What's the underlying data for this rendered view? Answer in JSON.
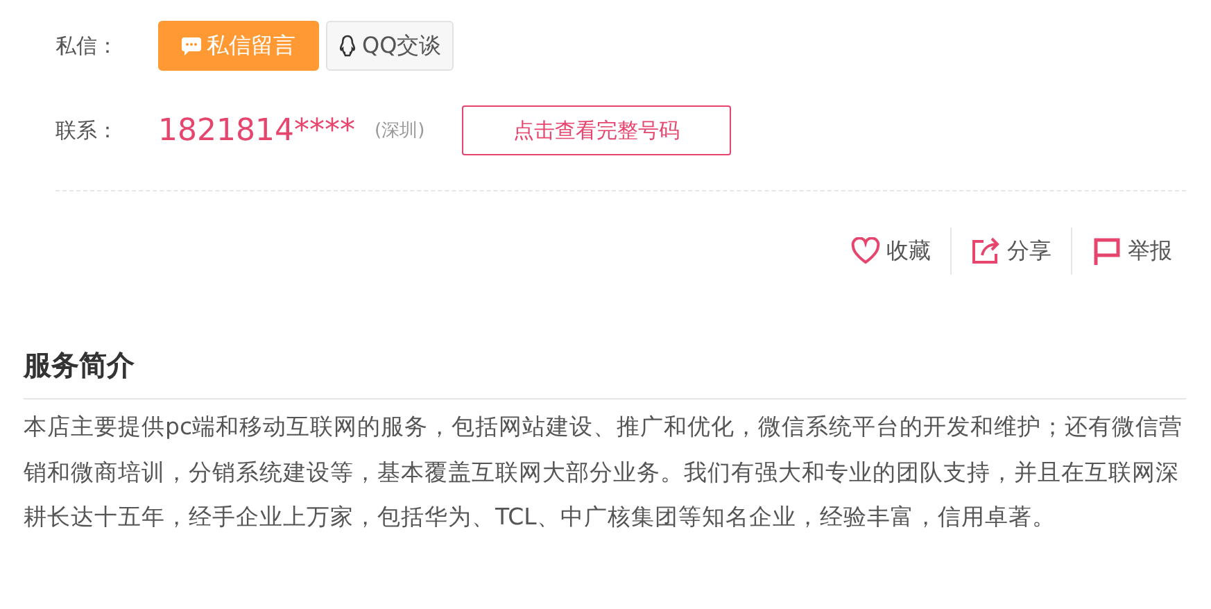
{
  "message_row": {
    "label": "私信：",
    "buttons": [
      {
        "kind": "message",
        "label": "私信留言"
      },
      {
        "kind": "qq",
        "label": "QQ交谈"
      }
    ]
  },
  "contact_row": {
    "label": "联系：",
    "phone": "1821814****",
    "city": "(深圳)",
    "reveal_button": "点击查看完整号码"
  },
  "actions": [
    {
      "kind": "favorite",
      "label": "收藏"
    },
    {
      "kind": "share",
      "label": "分享"
    },
    {
      "kind": "report",
      "label": "举报"
    }
  ],
  "service": {
    "title": "服务简介",
    "text": "本店主要提供pc端和移动互联网的服务，包括网站建设、推广和优化，微信系统平台的开发和维护；还有微信营销和微商培训，分销系统建设等，基本覆盖互联网大部分业务。我们有强大和专业的团队支持，并且在互联网深耕长达十五年，经手企业上万家，包括华为、TCL、中广核集团等知名企业，经验丰富，信用卓著。"
  }
}
